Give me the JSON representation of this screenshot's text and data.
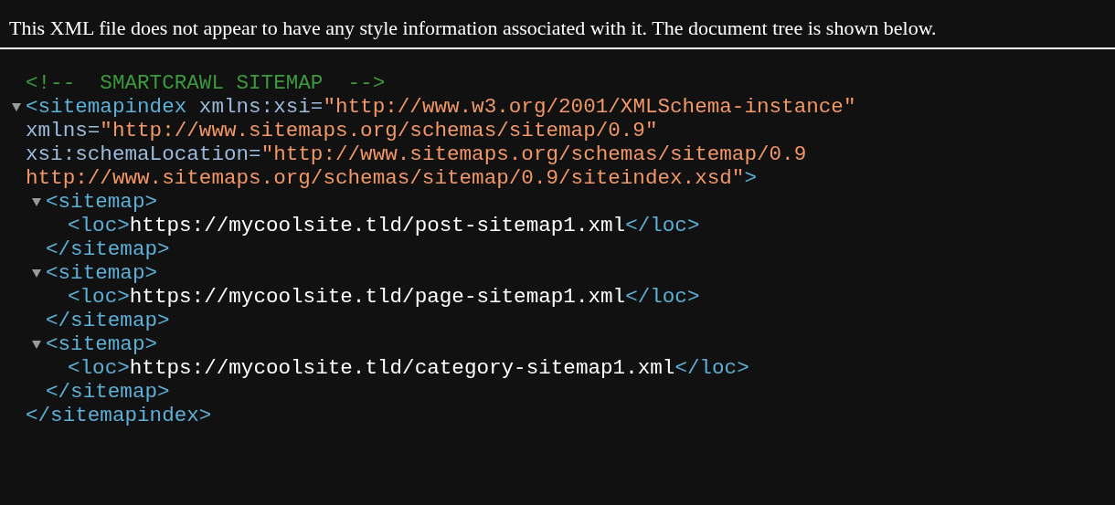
{
  "notice": "This XML file does not appear to have any style information associated with it. The document tree is shown below.",
  "comment": "<!--  SMARTCRAWL SITEMAP  -->",
  "root": {
    "expanded": true,
    "open_tag_lines": [
      [
        {
          "kind": "tag",
          "text": "<sitemapindex"
        },
        {
          "kind": "attr_name",
          "text": " xmlns:xsi="
        },
        {
          "kind": "attr_value",
          "text": "\"http://www.w3.org/2001/XMLSchema-instance\""
        }
      ],
      [
        {
          "kind": "attr_name",
          "text": "xmlns="
        },
        {
          "kind": "attr_value",
          "text": "\"http://www.sitemaps.org/schemas/sitemap/0.9\""
        }
      ],
      [
        {
          "kind": "attr_name",
          "text": "xsi:schemaLocation="
        },
        {
          "kind": "attr_value",
          "text": "\"http://www.sitemaps.org/schemas/sitemap/0.9"
        }
      ],
      [
        {
          "kind": "attr_value",
          "text": "http://www.sitemaps.org/schemas/sitemap/0.9/siteindex.xsd\""
        },
        {
          "kind": "tag",
          "text": ">"
        }
      ]
    ],
    "children": [
      {
        "expanded": true,
        "open": "<sitemap>",
        "loc_open": "<loc>",
        "url": "https://mycoolsite.tld/post-sitemap1.xml",
        "loc_close": "</loc>",
        "close": "</sitemap>"
      },
      {
        "expanded": true,
        "open": "<sitemap>",
        "loc_open": "<loc>",
        "url": "https://mycoolsite.tld/page-sitemap1.xml",
        "loc_close": "</loc>",
        "close": "</sitemap>"
      },
      {
        "expanded": true,
        "open": "<sitemap>",
        "loc_open": "<loc>",
        "url": "https://mycoolsite.tld/category-sitemap1.xml",
        "loc_close": "</loc>",
        "close": "</sitemap>"
      }
    ],
    "close": "</sitemapindex>"
  }
}
